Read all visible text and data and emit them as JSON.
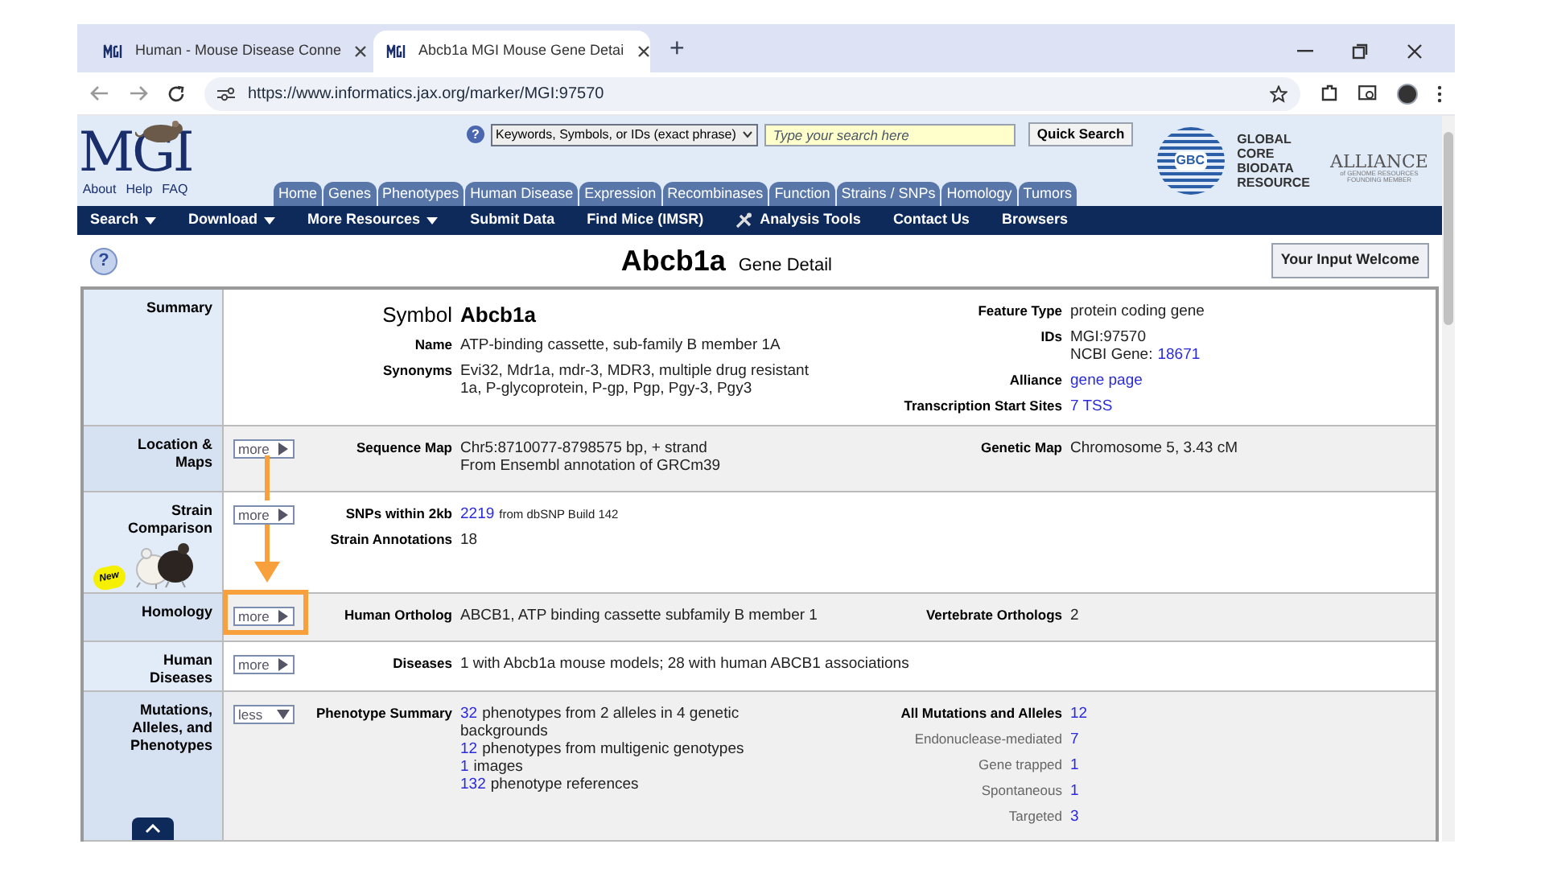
{
  "browser": {
    "tabs": [
      {
        "title": "Human - Mouse Disease Conne",
        "selected": false
      },
      {
        "title": "Abcb1a MGI Mouse Gene Detai",
        "selected": true
      }
    ],
    "new_tab": "+",
    "url": "https://www.informatics.jax.org/marker/MGI:97570"
  },
  "header": {
    "logo": "MGI",
    "logo_links": [
      "About",
      "Help",
      "FAQ"
    ],
    "search": {
      "help": "?",
      "scope": "Keywords, Symbols, or IDs (exact phrase)",
      "placeholder": "Type your search here",
      "button": "Quick Search"
    },
    "gbc": {
      "badge": "GBC",
      "lines": [
        "GLOBAL",
        "CORE",
        "BIODATA",
        "RESOURCE"
      ]
    },
    "alliance": {
      "name": "ALLIANCE",
      "sub": "of GENOME RESOURCES",
      "member": "FOUNDING MEMBER"
    },
    "tabs": [
      "Home",
      "Genes",
      "Phenotypes",
      "Human Disease",
      "Expression",
      "Recombinases",
      "Function",
      "Strains / SNPs",
      "Homology",
      "Tumors"
    ]
  },
  "nav": [
    {
      "label": "Search",
      "dropdown": true
    },
    {
      "label": "Download",
      "dropdown": true
    },
    {
      "label": "More Resources",
      "dropdown": true
    },
    {
      "label": "Submit Data",
      "dropdown": false
    },
    {
      "label": "Find Mice (IMSR)",
      "dropdown": false
    },
    {
      "label": "Analysis Tools",
      "dropdown": false,
      "tool_icon": true
    },
    {
      "label": "Contact Us",
      "dropdown": false
    },
    {
      "label": "Browsers",
      "dropdown": false
    }
  ],
  "title": {
    "help": "?",
    "symbol": "Abcb1a",
    "subtitle": "Gene Detail",
    "feedback_button": "Your Input Welcome"
  },
  "sections": [
    {
      "label": "Summary",
      "left": [
        {
          "label": "Symbol",
          "kind": "symbol",
          "lines": [
            [
              {
                "text": "Abcb1a",
                "kind": "text"
              }
            ]
          ]
        },
        {
          "label": "Name",
          "kind": "plain",
          "lines": [
            [
              {
                "text": "ATP-binding cassette, sub-family B member 1A",
                "kind": "text"
              }
            ]
          ]
        },
        {
          "label": "Synonyms",
          "kind": "plain",
          "lines": [
            [
              {
                "text": "Evi32, Mdr1a, mdr-3, MDR3, multiple drug resistant",
                "kind": "text"
              }
            ],
            [
              {
                "text": "1a, P-glycoprotein, P-gp, Pgp, Pgy-3, Pgy3",
                "kind": "text"
              }
            ]
          ]
        }
      ],
      "right": [
        {
          "label": "Feature Type",
          "kind": "plain",
          "lines": [
            [
              {
                "text": "protein coding gene",
                "kind": "text"
              }
            ]
          ]
        },
        {
          "label": "IDs",
          "kind": "plain",
          "lines": [
            [
              {
                "text": "MGI:97570",
                "kind": "text"
              }
            ],
            [
              {
                "text": "NCBI Gene:",
                "kind": "text"
              },
              {
                "text": "18671",
                "kind": "link"
              }
            ]
          ]
        },
        {
          "label": "Alliance",
          "kind": "plain",
          "lines": [
            [
              {
                "text": "gene page",
                "kind": "link"
              }
            ]
          ]
        },
        {
          "label": "Transcription Start Sites",
          "kind": "plain",
          "lines": [
            [
              {
                "text": "7 TSS",
                "kind": "link"
              }
            ]
          ]
        }
      ]
    },
    {
      "label": "Location & Maps",
      "toggle": {
        "label": "more",
        "expanded": false
      },
      "left": [
        {
          "label": "Sequence Map",
          "kind": "plain",
          "lines": [
            [
              {
                "text": "Chr5:8710077-8798575 bp, + strand",
                "kind": "text"
              }
            ],
            [
              {
                "text": "From Ensembl annotation of GRCm39",
                "kind": "text"
              }
            ]
          ]
        }
      ],
      "right": [
        {
          "label": "Genetic Map",
          "kind": "plain",
          "lines": [
            [
              {
                "text": "Chromosome 5, 3.43 cM",
                "kind": "text"
              }
            ]
          ]
        }
      ]
    },
    {
      "label": "Strain Comparison",
      "badge": "New",
      "toggle": {
        "label": "more",
        "expanded": false
      },
      "left": [
        {
          "label": "SNPs within 2kb",
          "kind": "plain",
          "lines": [
            [
              {
                "text": "2219",
                "kind": "link"
              },
              {
                "text": "from dbSNP Build 142",
                "kind": "small"
              }
            ]
          ]
        },
        {
          "label": "Strain Annotations",
          "kind": "plain",
          "lines": [
            [
              {
                "text": "18",
                "kind": "text"
              }
            ]
          ]
        }
      ]
    },
    {
      "label": "Homology",
      "toggle": {
        "label": "more",
        "expanded": false
      },
      "left": [
        {
          "label": "Human Ortholog",
          "kind": "plain",
          "lines": [
            [
              {
                "text": "ABCB1, ATP binding cassette subfamily B member 1",
                "kind": "text"
              }
            ]
          ]
        }
      ],
      "right": [
        {
          "label": "Vertebrate Orthologs",
          "kind": "plain",
          "lines": [
            [
              {
                "text": "2",
                "kind": "text"
              }
            ]
          ]
        }
      ]
    },
    {
      "label": "Human Diseases",
      "toggle": {
        "label": "more",
        "expanded": false
      },
      "left": [
        {
          "label": "Diseases",
          "kind": "plain",
          "lines": [
            [
              {
                "text": "1 with Abcb1a mouse models; 28 with human ABCB1 associations",
                "kind": "text"
              }
            ]
          ]
        }
      ]
    },
    {
      "label": "Mutations, Alleles, and Phenotypes",
      "toggle": {
        "label": "less",
        "expanded": true
      },
      "top_button": true,
      "left": [
        {
          "label": "Phenotype Summary",
          "kind": "plain",
          "lines": [
            [
              {
                "text": "32",
                "kind": "link"
              },
              {
                "text": "phenotypes from 2 alleles in 4 genetic",
                "kind": "text"
              }
            ],
            [
              {
                "text": "backgrounds",
                "kind": "text"
              }
            ],
            [
              {
                "text": "12",
                "kind": "link"
              },
              {
                "text": "phenotypes from multigenic genotypes",
                "kind": "text"
              }
            ],
            [
              {
                "text": "1",
                "kind": "link"
              },
              {
                "text": "images",
                "kind": "text"
              }
            ],
            [
              {
                "text": "132",
                "kind": "link"
              },
              {
                "text": "phenotype references",
                "kind": "text"
              }
            ]
          ]
        }
      ],
      "right": [
        {
          "label": "All Mutations and Alleles",
          "kind": "plain",
          "lines": [
            [
              {
                "text": "12",
                "kind": "link"
              }
            ]
          ]
        },
        {
          "label": "Endonuclease-mediated",
          "kind": "sub",
          "lines": [
            [
              {
                "text": "7",
                "kind": "link"
              }
            ]
          ]
        },
        {
          "label": "Gene trapped",
          "kind": "sub",
          "lines": [
            [
              {
                "text": "1",
                "kind": "link"
              }
            ]
          ]
        },
        {
          "label": "Spontaneous",
          "kind": "sub",
          "lines": [
            [
              {
                "text": "1",
                "kind": "link"
              }
            ]
          ]
        },
        {
          "label": "Targeted",
          "kind": "sub",
          "lines": [
            [
              {
                "text": "3",
                "kind": "link"
              }
            ]
          ]
        }
      ]
    }
  ]
}
